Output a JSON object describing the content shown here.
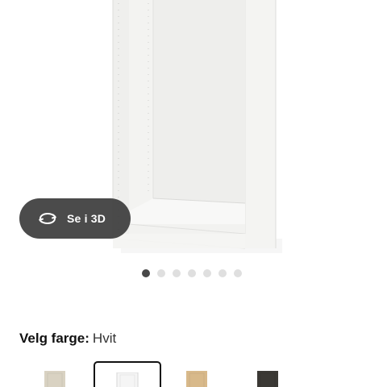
{
  "product": {
    "colors": {
      "frame": "#f4f4f2",
      "interior": "#ececea",
      "shadow": "#d8d8d5"
    }
  },
  "view_3d": {
    "label": "Se i 3D",
    "icon": "rotate-3d-icon"
  },
  "carousel": {
    "total": 7,
    "active_index": 1
  },
  "color_picker": {
    "prefix": "Velg farge:",
    "selected": "Hvit",
    "swatches": [
      {
        "name": "white-stained-oak",
        "color": "#d9d2c2",
        "selected": false
      },
      {
        "name": "white",
        "color": "#f5f5f5",
        "selected": true
      },
      {
        "name": "oak-effect",
        "color": "#d8b98a",
        "selected": false
      },
      {
        "name": "black-brown",
        "color": "#3b3935",
        "selected": false
      }
    ]
  }
}
